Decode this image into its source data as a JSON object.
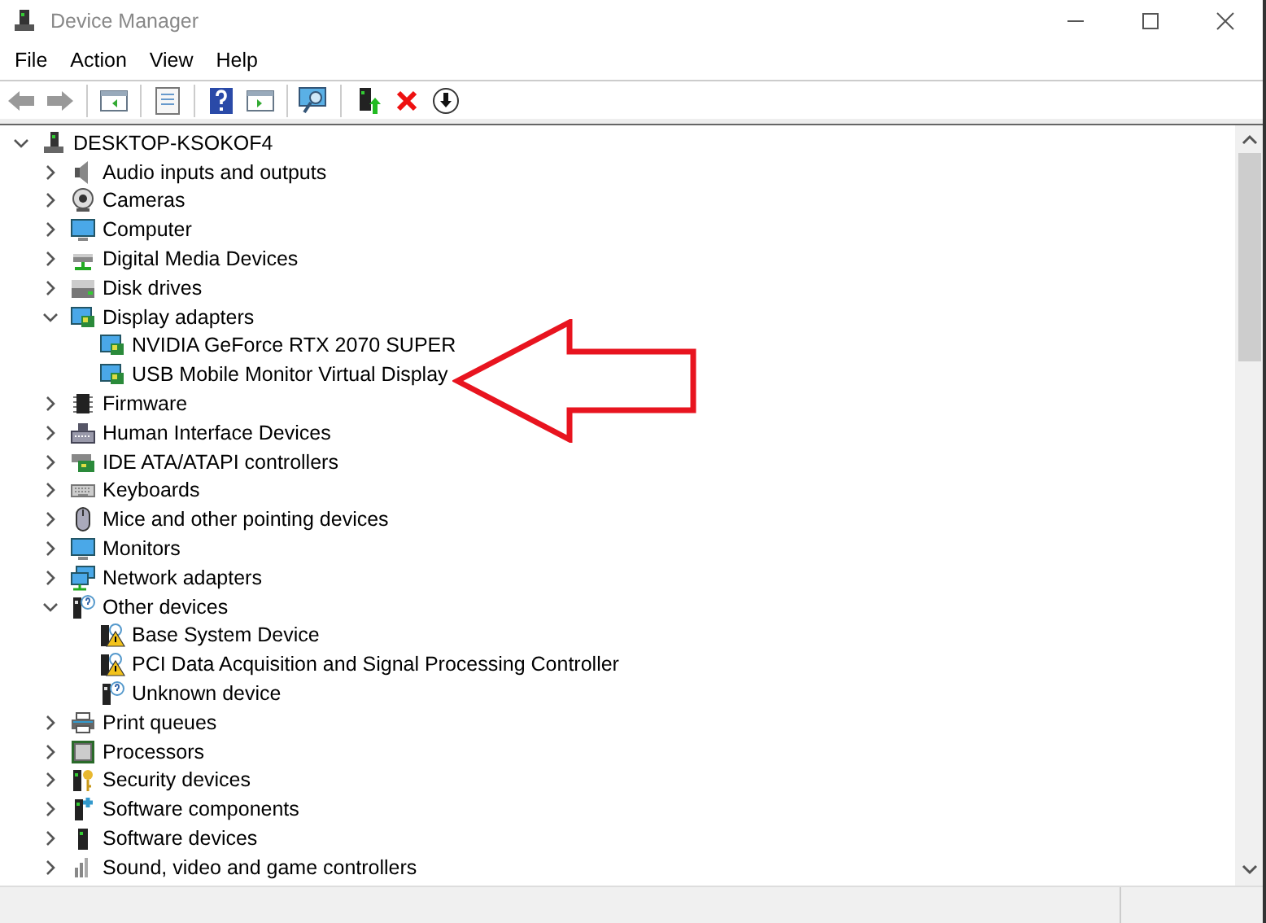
{
  "window": {
    "title": "Device Manager"
  },
  "menu": [
    "File",
    "Action",
    "View",
    "Help"
  ],
  "tree": {
    "label": "DESKTOP-KSOKOF4",
    "expanded": true,
    "children": [
      {
        "label": "Audio inputs and outputs",
        "expanded": false
      },
      {
        "label": "Cameras",
        "expanded": false
      },
      {
        "label": "Computer",
        "expanded": false
      },
      {
        "label": "Digital Media Devices",
        "expanded": false
      },
      {
        "label": "Disk drives",
        "expanded": false
      },
      {
        "label": "Display adapters",
        "expanded": true,
        "children": [
          {
            "label": "NVIDIA GeForce RTX 2070 SUPER"
          },
          {
            "label": "USB Mobile Monitor Virtual Display"
          }
        ]
      },
      {
        "label": "Firmware",
        "expanded": false
      },
      {
        "label": "Human Interface Devices",
        "expanded": false
      },
      {
        "label": "IDE ATA/ATAPI controllers",
        "expanded": false
      },
      {
        "label": "Keyboards",
        "expanded": false
      },
      {
        "label": "Mice and other pointing devices",
        "expanded": false
      },
      {
        "label": "Monitors",
        "expanded": false
      },
      {
        "label": "Network adapters",
        "expanded": false
      },
      {
        "label": "Other devices",
        "expanded": true,
        "children": [
          {
            "label": "Base System Device"
          },
          {
            "label": "PCI Data Acquisition and Signal Processing Controller"
          },
          {
            "label": "Unknown device"
          }
        ]
      },
      {
        "label": "Print queues",
        "expanded": false
      },
      {
        "label": "Processors",
        "expanded": false
      },
      {
        "label": "Security devices",
        "expanded": false
      },
      {
        "label": "Software components",
        "expanded": false
      },
      {
        "label": "Software devices",
        "expanded": false
      },
      {
        "label": "Sound, video and game controllers",
        "expanded": false
      }
    ]
  }
}
